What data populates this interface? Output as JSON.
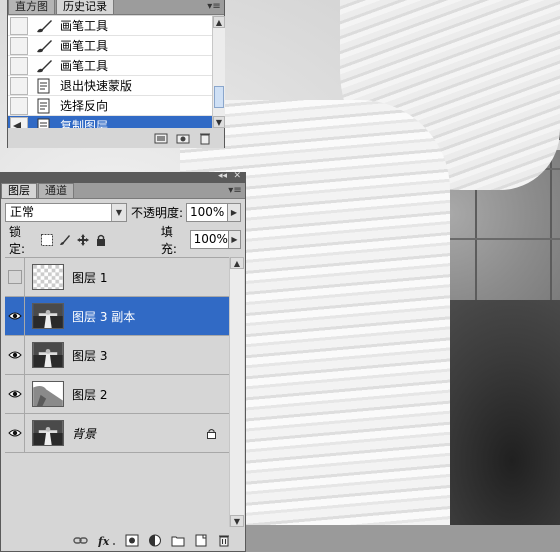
{
  "history_panel": {
    "tabs": [
      "直方图",
      "历史记录"
    ],
    "active_tab": 1,
    "items": [
      {
        "label": "画笔工具",
        "icon": "brush-icon"
      },
      {
        "label": "画笔工具",
        "icon": "brush-icon"
      },
      {
        "label": "画笔工具",
        "icon": "brush-icon"
      },
      {
        "label": "退出快速蒙版",
        "icon": "history-state-icon"
      },
      {
        "label": "选择反向",
        "icon": "history-state-icon"
      },
      {
        "label": "复制图层",
        "icon": "history-state-icon",
        "selected": true
      }
    ],
    "footer_icons": [
      "new-document-from-state-icon",
      "new-snapshot-icon",
      "delete-state-icon"
    ]
  },
  "layers_panel": {
    "tabs": [
      "图层",
      "通道"
    ],
    "active_tab": 0,
    "blend_mode": "正常",
    "opacity_label": "不透明度:",
    "opacity_value": "100%",
    "lock_label": "锁定:",
    "fill_label": "填充:",
    "fill_value": "100%",
    "layers": [
      {
        "name": "图层 1",
        "visible": false,
        "thumb": "transparent"
      },
      {
        "name": "图层 3 副本",
        "visible": true,
        "thumb": "photo",
        "selected": true
      },
      {
        "name": "图层 3",
        "visible": true,
        "thumb": "photo"
      },
      {
        "name": "图层 2",
        "visible": true,
        "thumb": "mask-gray"
      },
      {
        "name": "背景",
        "visible": true,
        "thumb": "photo",
        "locked": true,
        "italic": true
      }
    ],
    "footer_icons": [
      "link-layers-icon",
      "layer-style-fx-icon",
      "add-mask-icon",
      "adjustment-layer-icon",
      "new-group-icon",
      "new-layer-icon",
      "delete-layer-icon"
    ]
  },
  "colors": {
    "selection": "#316ac5",
    "panel_bg": "#d6d6d6"
  }
}
